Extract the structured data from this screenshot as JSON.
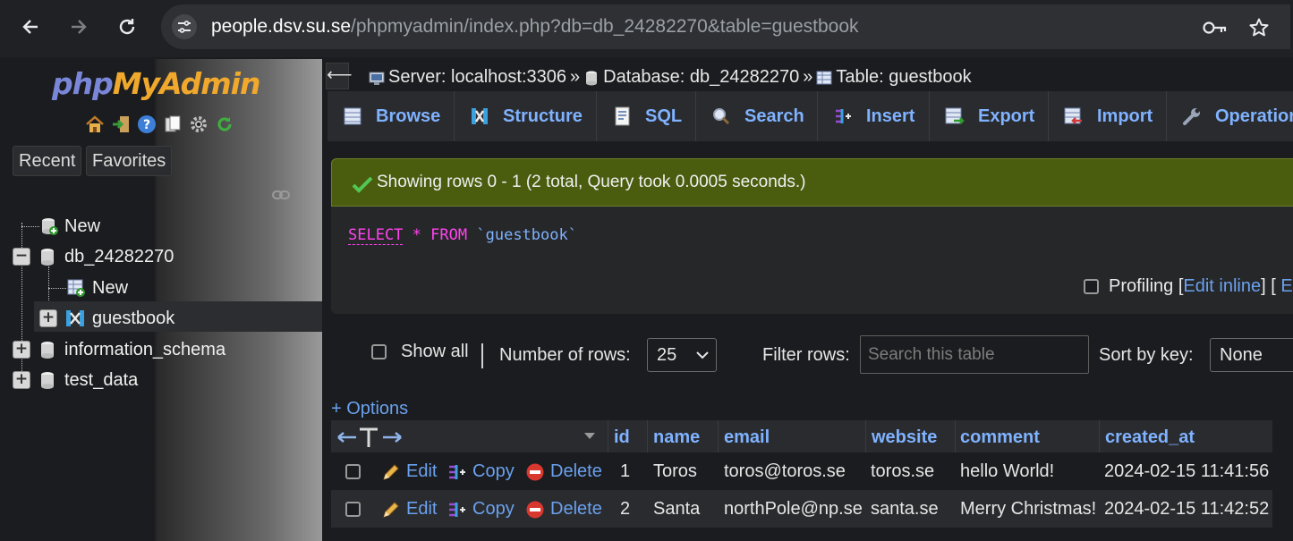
{
  "browser": {
    "url_host": "people.dsv.su.se",
    "url_path": "/phpmyadmin/index.php?db=db_24282270&table=guestbook",
    "icons": [
      "back-icon",
      "forward-icon",
      "reload-icon",
      "site-info-icon",
      "password-key-icon",
      "bookmark-star-icon"
    ]
  },
  "sidebar": {
    "logo": {
      "php": "php",
      "my": "My",
      "admin": "Admin"
    },
    "tabs": {
      "recent": "Recent",
      "favorites": "Favorites"
    },
    "tree": {
      "new_top": "New",
      "db_current": "db_24282270",
      "new_in_db": "New",
      "table": "guestbook",
      "db_info": "information_schema",
      "db_test": "test_data"
    }
  },
  "header": {
    "collapse": "⟵",
    "server": "Server: localhost:3306",
    "sep": "»",
    "database": "Database: db_24282270",
    "table": "Table: guestbook"
  },
  "tabs": [
    {
      "label": "Browse"
    },
    {
      "label": "Structure"
    },
    {
      "label": "SQL"
    },
    {
      "label": "Search"
    },
    {
      "label": "Insert"
    },
    {
      "label": "Export"
    },
    {
      "label": "Import"
    },
    {
      "label": "Operation"
    }
  ],
  "result_message": "Showing rows 0 - 1 (2 total, Query took 0.0005 seconds.)",
  "sql": {
    "select": "SELECT",
    "star": "*",
    "from": "FROM",
    "table": "`guestbook`"
  },
  "profiling": {
    "label": "Profiling",
    "open": "[",
    "edit_inline": "Edit inline",
    "mid": "] [",
    "edit_trunc": "Ed"
  },
  "controls": {
    "show_all": "Show all",
    "pipe": "|",
    "number_of_rows_label": "Number of rows:",
    "rows_value": "25",
    "filter_label": "Filter rows:",
    "filter_placeholder": "Search this table",
    "sort_label": "Sort by key:",
    "sort_value": "None"
  },
  "options_link": "+ Options",
  "table": {
    "columns": [
      "id",
      "name",
      "email",
      "website",
      "comment",
      "created_at"
    ],
    "actions": {
      "edit": "Edit",
      "copy": "Copy",
      "delete": "Delete"
    },
    "rows": [
      {
        "id": "1",
        "name": "Toros",
        "email": "toros@toros.se",
        "website": "toros.se",
        "comment": "hello World!",
        "created_at": "2024-02-15 11:41:56"
      },
      {
        "id": "2",
        "name": "Santa",
        "email": "northPole@np.se",
        "website": "santa.se",
        "comment": "Merry Christmas!",
        "created_at": "2024-02-15 11:42:52"
      }
    ]
  },
  "colors": {
    "link": "#6aa1ee",
    "tab_text": "#7fb2ff",
    "success_bg": "#4a5d0f",
    "sql_keyword": "#ff44ee"
  }
}
